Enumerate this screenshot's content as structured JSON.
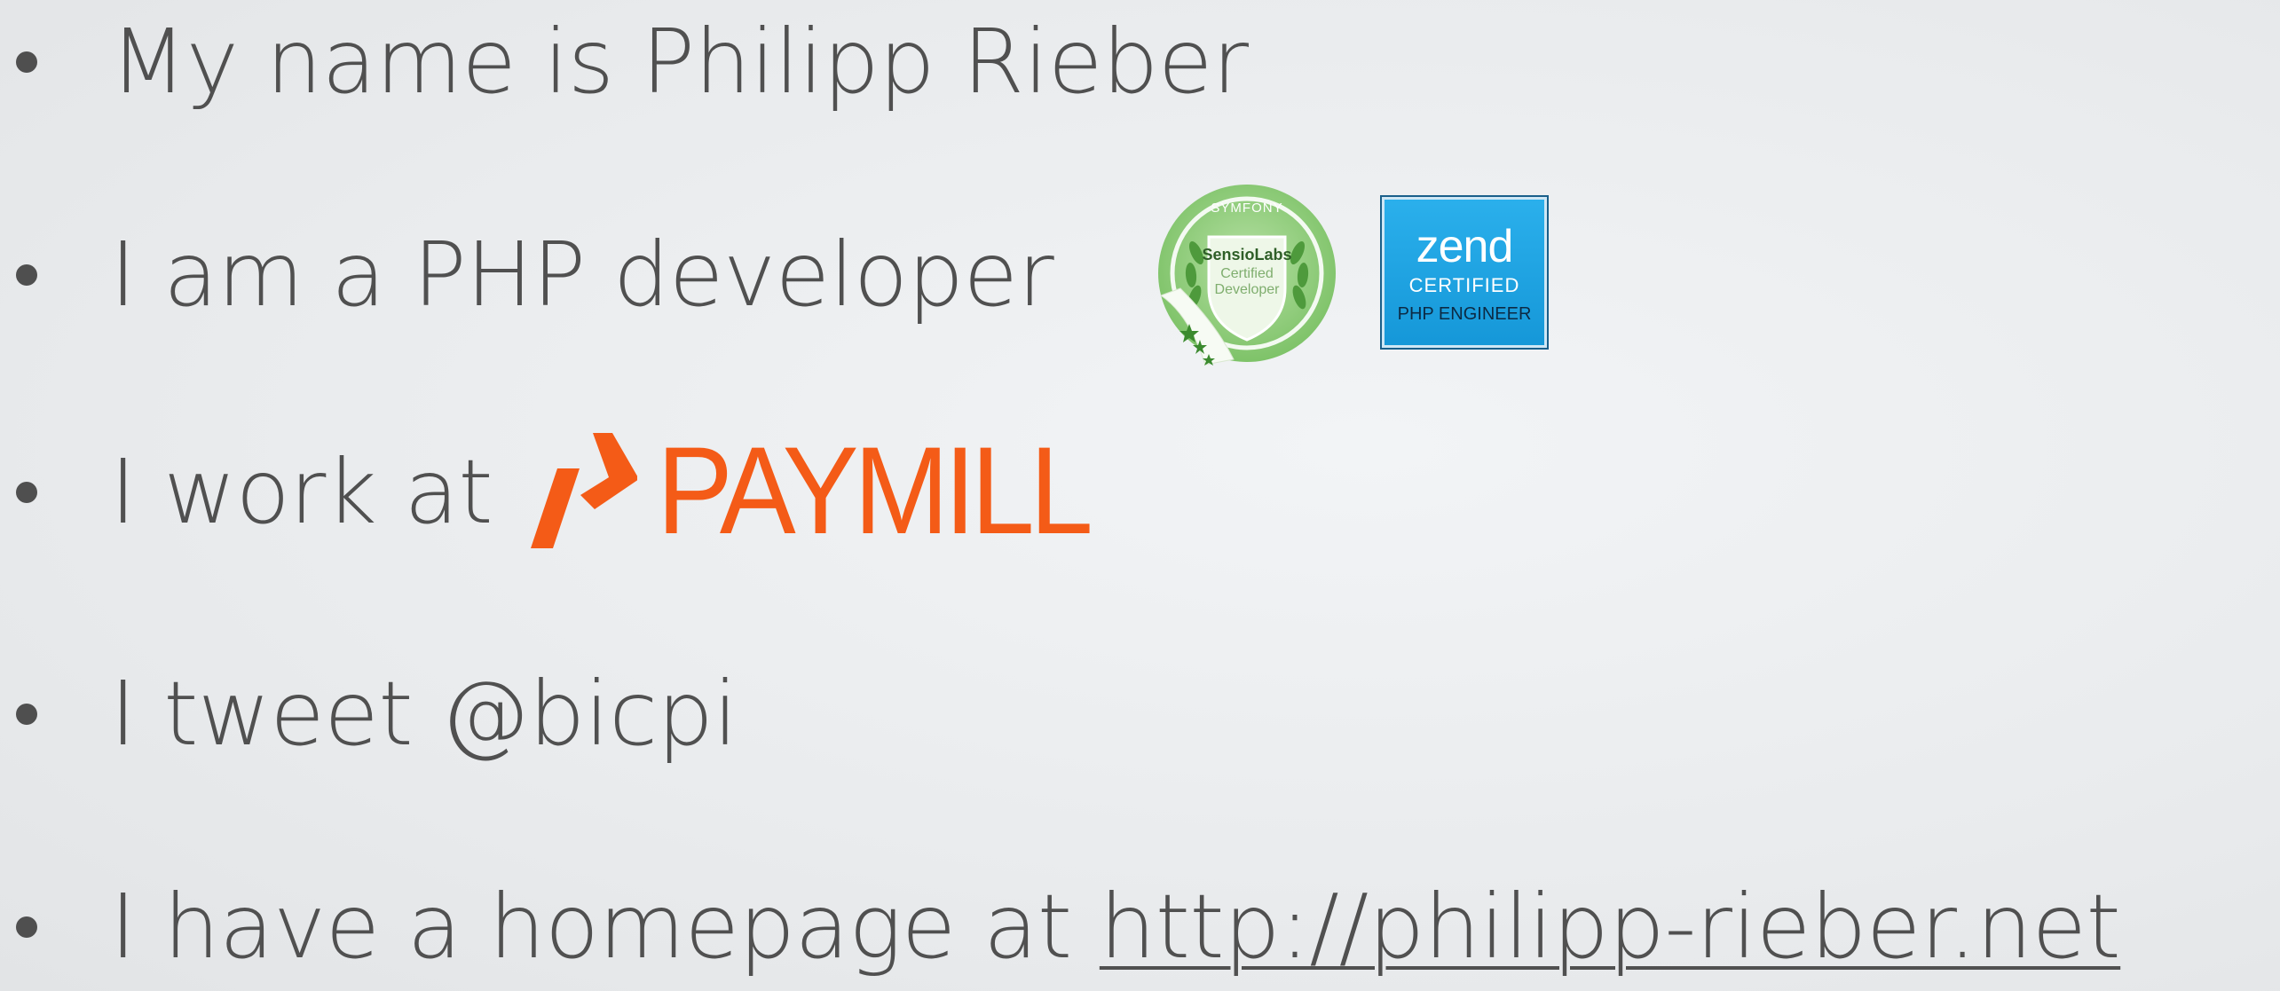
{
  "bullets": [
    {
      "text": "My name is Philipp Rieber"
    },
    {
      "text": "I am a PHP developer"
    },
    {
      "text": "I work at"
    },
    {
      "text": "I tweet @bicpi"
    },
    {
      "text": "I have a homepage at ",
      "link": "http://philipp-rieber.net"
    }
  ],
  "badges": {
    "symfony": {
      "top_text": "SYMFONY",
      "brand": "SensioLabs",
      "line1": "Certified",
      "line2": "Developer",
      "color": "#7dc36b"
    },
    "zend": {
      "word": "zend",
      "certified": "CERTIFIED",
      "php": "PHP ENGINEER",
      "color": "#1fa5e3"
    }
  },
  "paymill": {
    "word": "PAYMILL",
    "color": "#f45b17"
  },
  "colors": {
    "text": "#505050",
    "background": "#eceef0"
  }
}
